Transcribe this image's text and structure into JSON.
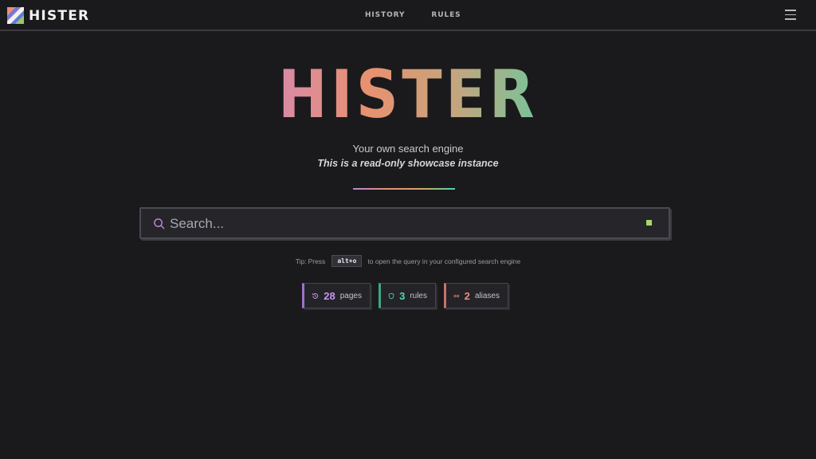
{
  "app": {
    "logo_text": "HISTER",
    "nav": [
      {
        "label": "HISTORY"
      },
      {
        "label": "RULES"
      }
    ]
  },
  "hero": {
    "title": "HISTER",
    "subtitle": "Your own search engine",
    "notice": "This is a read-only showcase instance"
  },
  "search": {
    "placeholder": "Search...",
    "value": ""
  },
  "tip": {
    "prefix": "Tip:",
    "press": "Press",
    "shortcut": "alt+o",
    "suffix": "to open the query in your configured search engine"
  },
  "stats": [
    {
      "count": "28",
      "label": "pages",
      "icon": "history-icon"
    },
    {
      "count": "3",
      "label": "rules",
      "icon": "shield-icon"
    },
    {
      "count": "2",
      "label": "aliases",
      "icon": "link-icon"
    }
  ],
  "colors": {
    "background": "#1a1a1c",
    "pages_accent": "#c994f0",
    "rules_accent": "#4ddaa5",
    "aliases_accent": "#ef8e7a",
    "status": "#a6d96a"
  }
}
